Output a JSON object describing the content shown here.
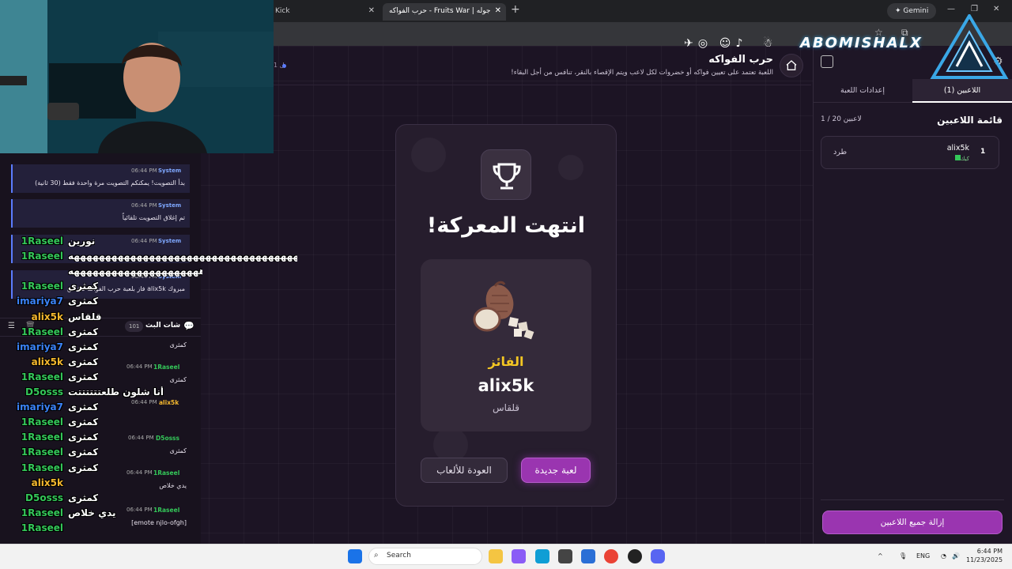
{
  "browser": {
    "tab_inactive": "Kick",
    "tab_active": "حرب الفواكه - Fruits War | جوله",
    "gemini_label": "Gemini",
    "star_icon": "star-icon"
  },
  "game": {
    "title": "حرب الفواكه",
    "description": "اللعبة تعتمد على تعيين فواكه أو خضروات لكل لاعب ويتم الإقصاء بالنقر، تنافس من أجل البقاء!",
    "round_indicator": "1 ل",
    "result": {
      "ended_title": "انتهت المعركة!",
      "winner_label": "الفائز",
      "winner_name": "alix5k",
      "winner_fruit": "قلقاس",
      "new_game_button": "لعبة جديدة",
      "back_button": "العودة للألعاب"
    }
  },
  "panel": {
    "tab_players": "اللاعبين (1)",
    "tab_settings": "إعدادات اللعبة",
    "list_title": "قائمة اللاعبين",
    "count": "1 / 20 لاعبين",
    "players": [
      {
        "number": "1",
        "name": "alix5k",
        "platform": "كيك",
        "kick_label": "طرد"
      }
    ],
    "remove_all_button": "إزالة جميع اللاعبين"
  },
  "overlay": {
    "brand": "ABOMISHALX"
  },
  "chat": {
    "title": "شات البث",
    "count": "101",
    "system_messages": [
      {
        "time": "06:44 PM",
        "name": "System",
        "text": "بدأ التصويت! يمكنكم التصويت مرة واحدة فقط (30 ثانية)"
      },
      {
        "time": "06:44 PM",
        "name": "System",
        "text": "تم إغلاق التصويت تلقائياً"
      },
      {
        "time": "06:44 PM",
        "name": "System",
        "text": ""
      },
      {
        "time": "06:44 PM",
        "name": "System",
        "text": "مبروك alix5k فاز بلعبة حرب الفواكه قلقاس"
      }
    ],
    "messages": [
      {
        "time": "",
        "user": "",
        "text": "كمثرى"
      },
      {
        "time": "06:44 PM",
        "user": "1Raseel",
        "text": "كمثرى"
      },
      {
        "time": "06:44 PM",
        "user": "alix5k",
        "text": ""
      },
      {
        "time": "06:44 PM",
        "user": "D5osss",
        "text": "كمثرى"
      },
      {
        "time": "06:44 PM",
        "user": "1Raseel",
        "text": "يدي خلاص"
      },
      {
        "time": "06:44 PM",
        "user": "1Raseel",
        "text": "[emote  njlo-ofgh]"
      }
    ],
    "overlay_lines": [
      {
        "user": "1Raseel",
        "text": "نورين",
        "color": "#34c759"
      },
      {
        "user": "1Raseel",
        "text": "ههههههههههههههههههههههههههههههههههههههه",
        "color": "#34c759"
      },
      {
        "user": "",
        "text": "هههههههههههههههههههههه",
        "color": "#34c759"
      },
      {
        "user": "1Raseel",
        "text": "كمثرى",
        "color": "#34c759"
      },
      {
        "user": "imariya7",
        "text": "كمثرى",
        "color": "#3b82f6"
      },
      {
        "user": "alix5k",
        "text": "قلقاس",
        "color": "#f5b82e"
      },
      {
        "user": "1Raseel",
        "text": "كمثرى",
        "color": "#34c759"
      },
      {
        "user": "imariya7",
        "text": "كمثرى",
        "color": "#3b82f6"
      },
      {
        "user": "alix5k",
        "text": "كمثرى",
        "color": "#f5b82e"
      },
      {
        "user": "1Raseel",
        "text": "كمثرى",
        "color": "#34c759"
      },
      {
        "user": "D5osss",
        "text": "أنا شلون طلعتتتتتتت",
        "color": "#34c759"
      },
      {
        "user": "imariya7",
        "text": "كمثرى",
        "color": "#3b82f6"
      },
      {
        "user": "1Raseel",
        "text": "كمثرى",
        "color": "#34c759"
      },
      {
        "user": "1Raseel",
        "text": "كمثرى",
        "color": "#34c759"
      },
      {
        "user": "1Raseel",
        "text": "كمثرى",
        "color": "#34c759"
      },
      {
        "user": "1Raseel",
        "text": "كمثرى",
        "color": "#34c759"
      },
      {
        "user": "alix5k",
        "text": "",
        "color": "#f5b82e"
      },
      {
        "user": "D5osss",
        "text": "كمثرى",
        "color": "#34c759"
      },
      {
        "user": "1Raseel",
        "text": "يدي خلاص",
        "color": "#34c759"
      },
      {
        "user": "1Raseel",
        "text": "",
        "color": "#34c759"
      }
    ]
  },
  "taskbar": {
    "search_placeholder": "Search",
    "lang": "ENG",
    "time": "6:44 PM",
    "date": "11/23/2025"
  },
  "colors": {
    "accent_purple": "#9a35b0",
    "winner_gold": "#f3c623",
    "kick_green": "#34c759",
    "system_blue": "#7fa8ff"
  }
}
